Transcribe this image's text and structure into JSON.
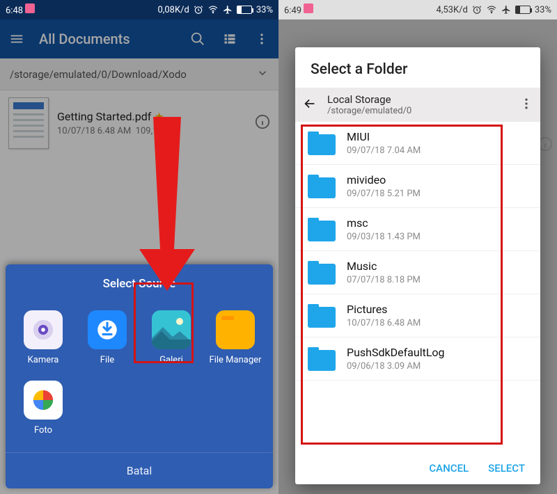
{
  "left": {
    "status": {
      "time": "6:48",
      "net": "0,08K/d",
      "battery": "33%"
    },
    "toolbar": {
      "title": "All Documents"
    },
    "path": "/storage/emulated/0/Download/Xodo",
    "file": {
      "name": "Getting Started.pdf",
      "starred": true,
      "date": "10/07/18 6.48 AM",
      "size": "109,1 KB"
    },
    "sheet": {
      "title": "Select Source",
      "items": [
        {
          "id": "kamera",
          "label": "Kamera"
        },
        {
          "id": "file",
          "label": "File"
        },
        {
          "id": "galeri",
          "label": "Galeri"
        },
        {
          "id": "filemanager",
          "label": "File Manager"
        },
        {
          "id": "foto",
          "label": "Foto"
        }
      ],
      "cancel": "Batal"
    }
  },
  "right": {
    "status": {
      "time": "6:49",
      "net": "4,53K/d",
      "battery": "33%"
    },
    "dialog": {
      "title": "Select a Folder",
      "storage_label": "Local Storage",
      "storage_path": "/storage/emulated/0",
      "folders": [
        {
          "name": "MIUI",
          "date": "09/07/18 7.04 AM"
        },
        {
          "name": "mivideo",
          "date": "09/07/18 5.21 PM"
        },
        {
          "name": "msc",
          "date": "09/03/18 1.43 PM"
        },
        {
          "name": "Music",
          "date": "07/07/18 8.18 PM"
        },
        {
          "name": "Pictures",
          "date": "10/07/18 6.48 AM"
        },
        {
          "name": "PushSdkDefaultLog",
          "date": "09/06/18 3.09 AM"
        }
      ],
      "cancel": "CANCEL",
      "select": "SELECT"
    }
  }
}
